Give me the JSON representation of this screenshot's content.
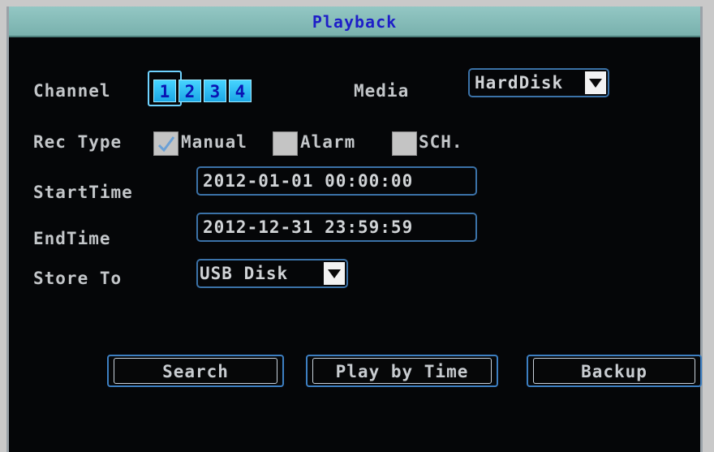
{
  "window": {
    "title": "Playback"
  },
  "channel": {
    "label": "Channel",
    "options": [
      "1",
      "2",
      "3",
      "4"
    ],
    "selected": "1"
  },
  "media": {
    "label": "Media",
    "value": "HardDisk"
  },
  "rec_type": {
    "label": "Rec Type",
    "options": [
      {
        "label": "Manual",
        "checked": true
      },
      {
        "label": "Alarm",
        "checked": false
      },
      {
        "label": "SCH.",
        "checked": false
      }
    ]
  },
  "start_time": {
    "label": "StartTime",
    "value": "2012-01-01 00:00:00"
  },
  "end_time": {
    "label": "EndTime",
    "value": "2012-12-31 23:59:59"
  },
  "store_to": {
    "label": "Store To",
    "value": "USB Disk"
  },
  "buttons": {
    "search": "Search",
    "play_by_time": "Play by Time",
    "backup": "Backup"
  },
  "colors": {
    "title_bar": "#86bcb8",
    "title_text": "#1e1ec8",
    "channel_button": "#2fbff5",
    "field_border": "#3b72a8",
    "background": "#050608"
  }
}
